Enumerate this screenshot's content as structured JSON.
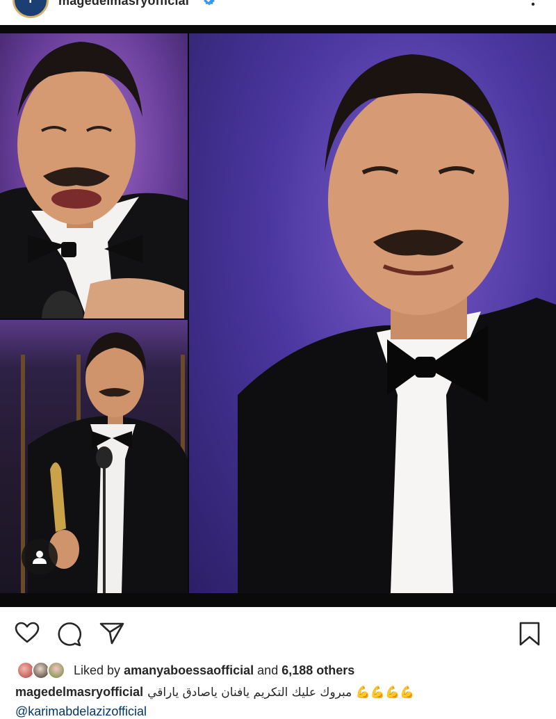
{
  "header": {
    "username": "magedelmasryofficial",
    "avatar_initial": "f"
  },
  "post": {
    "likes": {
      "prefix": "Liked by",
      "user": "amanyaboessaofficial",
      "conjunction": "and",
      "count_text": "6,188 others"
    },
    "caption": {
      "user": "magedelmasryofficial",
      "text": "مبروك عليك التكريم يافنان ياصادق ياراقي 💪💪💪💪",
      "mention": "@karimabdelazizofficial"
    }
  },
  "icons": [
    "more-icon",
    "verified-badge-icon",
    "tagged-user-icon",
    "heart-icon",
    "comment-icon",
    "share-icon",
    "bookmark-icon"
  ],
  "colors": {
    "verified": "#3897f0",
    "mention": "#00376b",
    "text": "#262626",
    "frame": "#0a0a0a"
  }
}
